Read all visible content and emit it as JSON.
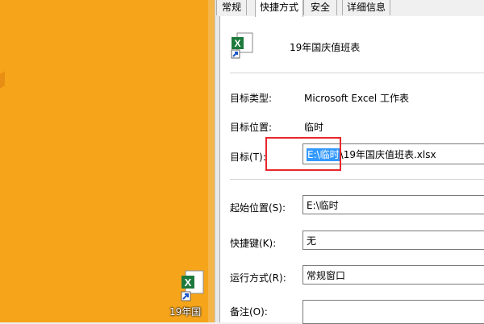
{
  "desktop": {
    "bg_color": "#f6a51a",
    "shortcut_label": "19年国"
  },
  "dialog": {
    "tabs": [
      {
        "label": "常规",
        "active": false
      },
      {
        "label": "快捷方式",
        "active": true
      },
      {
        "label": "安全",
        "active": false
      },
      {
        "label": "详细信息",
        "active": false
      }
    ],
    "file_name": "19年国庆值班表",
    "fields": {
      "type_label": "目标类型:",
      "type_value": "Microsoft Excel 工作表",
      "location_label": "目标位置:",
      "location_value": "临时",
      "target_label": "目标(T):",
      "target_selected": "E:\\临时",
      "target_rest": "\\19年国庆值班表.xlsx",
      "startin_label": "起始位置(S):",
      "startin_value": "E:\\临时",
      "hotkey_label": "快捷键(K):",
      "hotkey_value": "无",
      "run_label": "运行方式(R):",
      "run_value": "常规窗口",
      "comment_label": "备注(O):",
      "comment_value": ""
    }
  }
}
